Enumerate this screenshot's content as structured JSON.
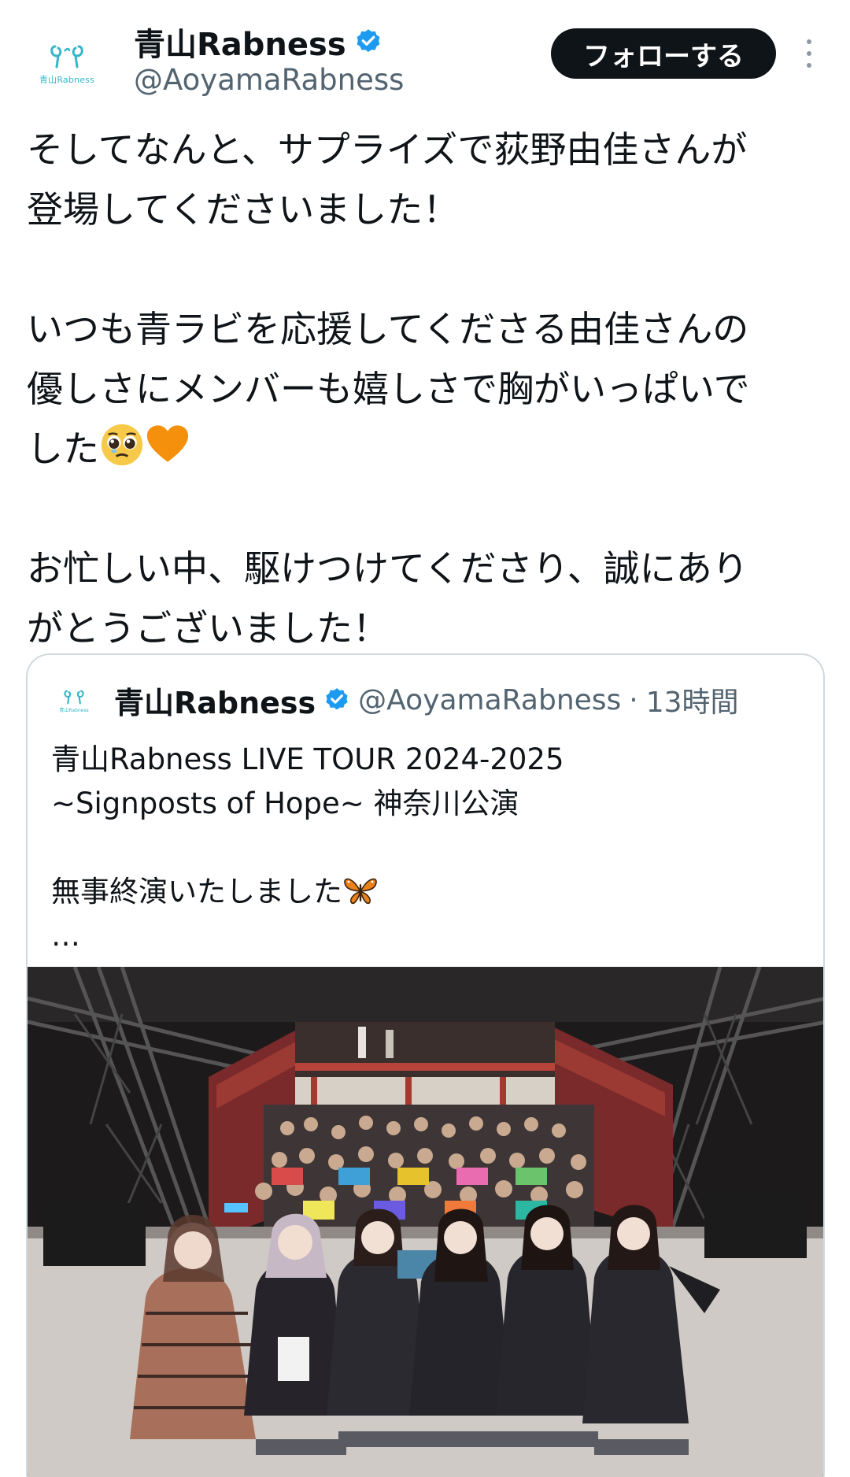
{
  "account": {
    "display_name": "青山Rabness",
    "handle": "@AoyamaRabness",
    "avatar_caption": "青山Rabness",
    "follow_label": "フォローする"
  },
  "tweet": {
    "paragraphs": [
      [
        "そしてなんと、サプライズで荻野由佳さんが",
        "登場してくださいました！"
      ],
      [
        "いつも青ラビを応援してくださる由佳さんの",
        "優しさにメンバーも嬉しさで胸がいっぱいで",
        "した"
      ],
      [
        "お忙しい中、駆けつけてくださり、誠にあり",
        "がとうございました！"
      ]
    ],
    "emojis": [
      "pleading-face-emoji",
      "orange-heart-emoji"
    ]
  },
  "quoted_tweet": {
    "display_name": "青山Rabness",
    "handle": "@AoyamaRabness",
    "separator": "·",
    "time": "13時間",
    "avatar_caption": "青山Rabness",
    "lines": [
      "青山Rabness LIVE TOUR 2024-2025",
      "~Signposts of Hope~ 神奈川公演"
    ],
    "line_after_gap": "無事終演いたしました",
    "ellipsis": "…",
    "photo_icon": "group-photo-on-stage"
  },
  "colors": {
    "text": "#0f1419",
    "secondary": "#536471",
    "verified": "#1d9bf0",
    "follow_bg": "#0f1419",
    "border": "#cfd9de",
    "brand": "#35b6c8"
  }
}
